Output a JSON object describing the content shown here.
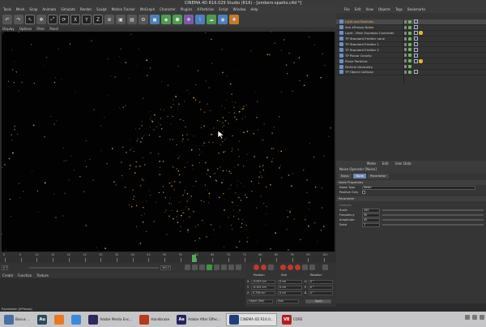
{
  "window": {
    "title": "CINEMA 4D R16.029 Studio (R16) - [embers-sparks.c4d *]"
  },
  "menubar": [
    "Tools",
    "Mesh",
    "Snap",
    "Animate",
    "Simulate",
    "Render",
    "Sculpt",
    "Motion Tracker",
    "MoGraph",
    "Character",
    "Plugins",
    "X-Particles",
    "Script",
    "Window",
    "Help"
  ],
  "toolbar": {
    "axis_x": "X",
    "axis_y": "Y",
    "axis_z": "Z"
  },
  "viewport": {
    "menu": [
      "Display",
      "Options",
      "Filter",
      "Panel"
    ]
  },
  "object_manager": {
    "menu": [
      "File",
      "Edit",
      "View",
      "Objects",
      "Tags",
      "Bookmarks"
    ],
    "items": [
      {
        "label": "Light and Particles",
        "selected": true
      },
      {
        "label": "See XPresso Notes",
        "selected": false
      },
      {
        "label": "Light - Main Expresso Controller",
        "selected": false
      },
      {
        "label": "TP Standard Emitter none",
        "selected": false
      },
      {
        "label": "TP Standard Emitter 1",
        "selected": false
      },
      {
        "label": "TP Standard Emitter 2",
        "selected": false
      },
      {
        "label": "TP Planar Gravity",
        "selected": false
      },
      {
        "label": "Plane Particles",
        "selected": false
      },
      {
        "label": "Particle Geometry",
        "selected": false
      },
      {
        "label": "TP Object Collision",
        "selected": false
      }
    ]
  },
  "attributes": {
    "menu": [
      "Mode",
      "Edit",
      "User Data"
    ],
    "title": "Noise Operator [Noise]",
    "tabs": [
      "Basic",
      "Node",
      "Parameter"
    ],
    "sections": {
      "node_properties": "Node Properties",
      "parameter": "Parameter"
    },
    "node_props": [
      {
        "label": "Noise Type",
        "value": "Noise"
      },
      {
        "label": "Positive Only"
      }
    ],
    "octaves_label": "Octaves",
    "params": [
      {
        "label": "Scale",
        "value": "100"
      },
      {
        "label": "Frequency",
        "value": "40"
      },
      {
        "label": "Amplitude",
        "value": "40"
      },
      {
        "label": "Seed",
        "value": "1"
      }
    ]
  },
  "timeline": {
    "ticks": [
      "0",
      "5",
      "10",
      "15",
      "20",
      "25",
      "30",
      "35",
      "40",
      "45",
      "50",
      "55",
      "60",
      "65",
      "70",
      "75",
      "80",
      "85",
      "90",
      "95",
      "100"
    ],
    "end_frame": "300 F",
    "current_frame": "0 F"
  },
  "material_manager": {
    "menu": [
      "Create",
      "Function",
      "Texture"
    ]
  },
  "coordinates": {
    "headers": [
      "Position",
      "Size",
      "Rotation"
    ],
    "rows": [
      {
        "axis": "X",
        "pos": "-0.053 cm",
        "size": "0 cm",
        "rot_axis": "H",
        "rot": "0 °"
      },
      {
        "axis": "Y",
        "pos": "-0.102 cm",
        "size": "0 cm",
        "rot_axis": "P",
        "rot": "0 °"
      },
      {
        "axis": "Z",
        "pos": "0.756 cm",
        "size": "0 cm",
        "rot_axis": "B",
        "rot": "0 °"
      }
    ],
    "mode": "Object (Rel)",
    "size_mode": "Size",
    "apply": "Apply"
  },
  "status": {
    "text": "Expression [XPresso]"
  },
  "taskbar": {
    "items": [
      {
        "label": "Bonus ...",
        "icon_text": "",
        "color": "#4a6fa5"
      },
      {
        "label": "",
        "icon_text": "Au",
        "color": "#2e4a5a"
      },
      {
        "label": "",
        "icon_text": "",
        "color": "#e8791f"
      },
      {
        "label": "",
        "icon_text": "",
        "color": "#3b8bd8"
      },
      {
        "label": "Adobe Media Enc...",
        "icon_text": "",
        "color": "#2c2c5a"
      },
      {
        "label": "Handbrake",
        "icon_text": "",
        "color": "#b83a1c"
      },
      {
        "label": "Adobe After Effec...",
        "icon_text": "Ae",
        "color": "#25255c"
      },
      {
        "label": "CINEMA 4D R16.0...",
        "icon_text": "",
        "color": "#1e3f7a"
      },
      {
        "label": "CORE",
        "icon_text": "V8",
        "color": "#b51f1f"
      }
    ]
  },
  "colors": {
    "accent": "#f2b04a",
    "particle": "#e8a24a",
    "background": "#020202"
  }
}
